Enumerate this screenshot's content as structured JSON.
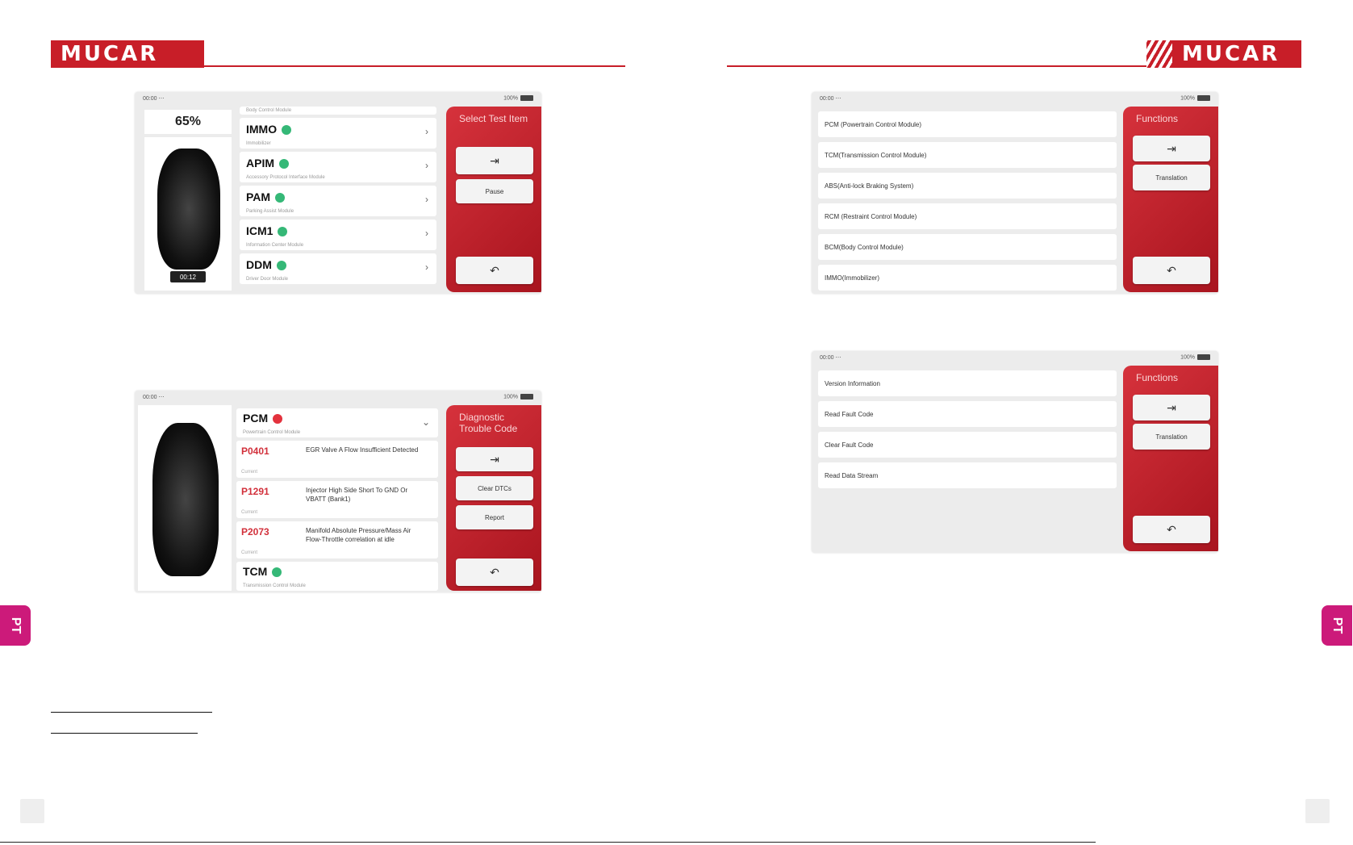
{
  "brand": {
    "name": "MUCAR",
    "color": "#c81e28",
    "tab_color": "#cc1a7a"
  },
  "side_tab": "PT",
  "screen1": {
    "status_time": "00:00 ⋯",
    "status_battery": "100%",
    "progress": "65%",
    "timer": "00:12",
    "top_module_sub": "Body Control Module",
    "modules": [
      {
        "name": "IMMO",
        "sub": "Immobilizer",
        "status": "ok"
      },
      {
        "name": "APIM",
        "sub": "Accessory Protocol Interface Module",
        "status": "ok"
      },
      {
        "name": "PAM",
        "sub": "Parking Assist Module",
        "status": "ok"
      },
      {
        "name": "ICM1",
        "sub": "Information Center Module",
        "status": "ok"
      },
      {
        "name": "DDM",
        "sub": "Driver Door Module",
        "status": "ok"
      }
    ],
    "panel_title": "Select Test Item",
    "btn_exit_icon": "exit-icon",
    "btn_pause": "Pause",
    "btn_back_icon": "back-icon"
  },
  "screen2": {
    "status_time": "00:00 ⋯",
    "status_battery": "100%",
    "panel_title": "Diagnostic Trouble Code",
    "module_name": "PCM",
    "module_sub": "Powertrain Control Module",
    "dtcs": [
      {
        "code": "P0401",
        "status": "Current",
        "desc": "EGR Valve A Flow Insufficient Detected"
      },
      {
        "code": "P1291",
        "status": "Current",
        "desc": "Injector High Side Short To GND Or VBATT (Bank1)"
      },
      {
        "code": "P2073",
        "status": "Current",
        "desc": "Manifold Absolute Pressure/Mass Air Flow-Throttle correlation at idle"
      }
    ],
    "tcm_name": "TCM",
    "tcm_sub": "Transmission Control Module",
    "btn_clear": "Clear DTCs",
    "btn_report": "Report"
  },
  "screen3": {
    "status_time": "00:00 ⋯",
    "status_battery": "100%",
    "panel_title": "Functions",
    "items": [
      "PCM (Powertrain Control Module)",
      "TCM(Transmission Control Module)",
      "ABS(Anti-lock Braking System)",
      "RCM (Restraint Control Module)",
      "BCM(Body Control Module)",
      "IMMO(Immobilizer)"
    ],
    "btn_translation": "Translation"
  },
  "screen4": {
    "status_time": "00:00 ⋯",
    "status_battery": "100%",
    "panel_title": "Functions",
    "items": [
      "Version Information",
      "Read Fault Code",
      "Clear Fault Code",
      "Read Data Stream"
    ],
    "btn_translation": "Translation"
  }
}
